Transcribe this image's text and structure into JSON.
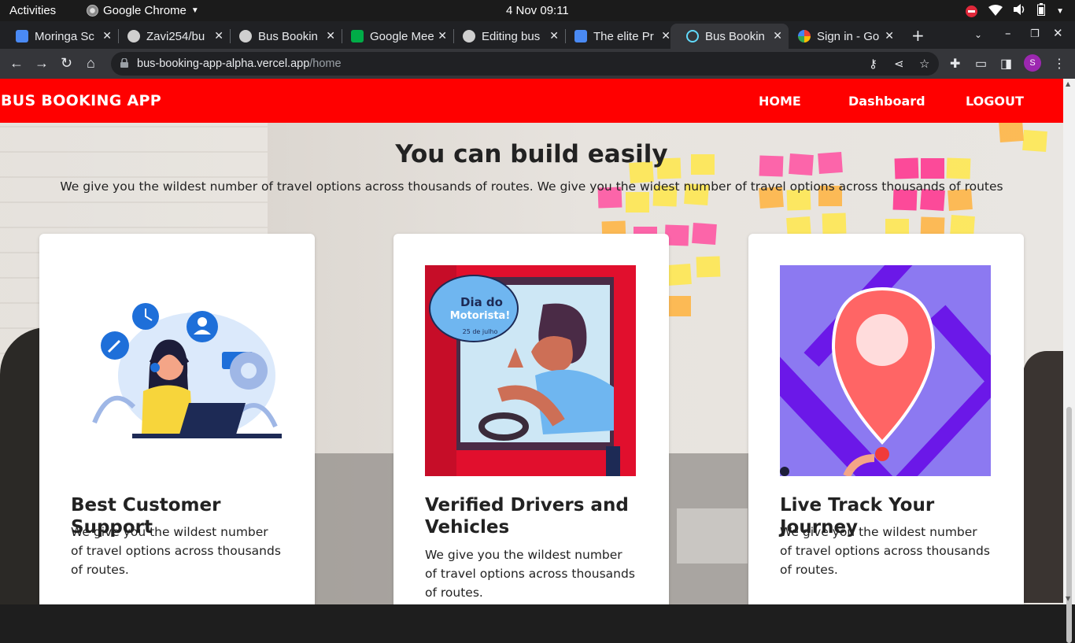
{
  "system_bar": {
    "activities": "Activities",
    "app_name": "Google Chrome",
    "clock": "4 Nov  09:11"
  },
  "tabs": [
    {
      "title": "Moringa Sc",
      "icon": "moringa-icon",
      "color": "#4a8af4"
    },
    {
      "title": "Zavi254/bu",
      "icon": "github-icon",
      "color": "#cfcfcf"
    },
    {
      "title": "Bus Bookin",
      "icon": "globe-icon",
      "color": "#cfcfcf"
    },
    {
      "title": "Google Mee",
      "icon": "meet-icon",
      "color": "#00ac47"
    },
    {
      "title": "Editing bus",
      "icon": "github-icon",
      "color": "#cfcfcf"
    },
    {
      "title": "The elite Pr",
      "icon": "docs-icon",
      "color": "#4a8af4"
    },
    {
      "title": "Bus Bookin",
      "icon": "react-icon",
      "color": "#61dafb"
    },
    {
      "title": "Sign in - Go",
      "icon": "google-icon",
      "color": "#ea4335"
    }
  ],
  "address_bar": {
    "domain": "bus-booking-app-alpha.vercel.app",
    "path": "/home"
  },
  "profile_initial": "S",
  "navbar": {
    "brand": "BUS BOOKING APP",
    "links": [
      "HOME",
      "Dashboard",
      "LOGOUT"
    ],
    "color": "#ff0000"
  },
  "hero": {
    "title": "You can build easily",
    "subtitle": "We give you the wildest number of travel options across thousands of routes. We give you the widest number of travel options across thousands of routes"
  },
  "cards": [
    {
      "title": "Best Customer Support",
      "text": "We give you the wildest number of travel options across thousands of routes."
    },
    {
      "title": "Verified Drivers and Vehicles",
      "text": "We give you the wildest number of travel options across thousands of routes."
    },
    {
      "title": "Live Track Your Journey",
      "text": "We give you the wildest number of travel options across thousands of routes."
    }
  ],
  "illustration_text": {
    "bubble_line1": "Dia do",
    "bubble_line2": "Motorista!",
    "bubble_date": "25 de julho"
  }
}
